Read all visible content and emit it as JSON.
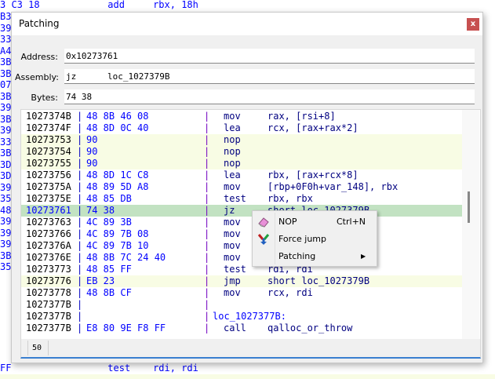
{
  "background": {
    "lines": [
      {
        "text": "3 C3 18            add     rbx, 18h"
      },
      {
        "text": "FF                 test    rdi, rdi"
      }
    ],
    "left_column": [
      "B3",
      "39",
      "33",
      "A4",
      "3B",
      "3B",
      "07",
      "3B",
      "39",
      "3B",
      "39",
      "33",
      "3B",
      "3D",
      "3D",
      "39",
      "35",
      "48",
      "39",
      "39",
      "39",
      "3B",
      "35"
    ]
  },
  "dialog": {
    "title": "Patching",
    "close_label": "x",
    "fields": [
      {
        "label": "Address:",
        "value": "0x10273761"
      },
      {
        "label": "Assembly:",
        "value": "jz      loc_1027379B"
      },
      {
        "label": "Bytes:",
        "value": "74 38"
      }
    ],
    "listing": {
      "rows": [
        {
          "addr": "1027374B",
          "bytes": "48 8B 46 08",
          "mn": "mov",
          "op": "rax, [rsi+8]",
          "hl": ""
        },
        {
          "addr": "1027374F",
          "bytes": "48 8D 0C 40",
          "mn": "lea",
          "op": "rcx, [rax+rax*2]",
          "hl": ""
        },
        {
          "addr": "10273753",
          "bytes": "90",
          "mn": "nop",
          "op": "",
          "hl": "patched"
        },
        {
          "addr": "10273754",
          "bytes": "90",
          "mn": "nop",
          "op": "",
          "hl": "patched"
        },
        {
          "addr": "10273755",
          "bytes": "90",
          "mn": "nop",
          "op": "",
          "hl": "patched"
        },
        {
          "addr": "10273756",
          "bytes": "48 8D 1C C8",
          "mn": "lea",
          "op": "rbx, [rax+rcx*8]",
          "hl": ""
        },
        {
          "addr": "1027375A",
          "bytes": "48 89 5D A8",
          "mn": "mov",
          "op": "[rbp+0F0h+var_148], rbx",
          "hl": ""
        },
        {
          "addr": "1027375E",
          "bytes": "48 85 DB",
          "mn": "test",
          "op": "rbx, rbx",
          "hl": ""
        },
        {
          "addr": "10273761",
          "bytes": "74 38",
          "mn": "jz",
          "op": "short loc_1027379B",
          "hl": "selected"
        },
        {
          "addr": "10273763",
          "bytes": "4C 89 3B",
          "mn": "mov",
          "op": "",
          "hl": ""
        },
        {
          "addr": "10273766",
          "bytes": "4C 89 7B 08",
          "mn": "mov",
          "op": "",
          "hl": ""
        },
        {
          "addr": "1027376A",
          "bytes": "4C 89 7B 10",
          "mn": "mov",
          "op": "",
          "hl": ""
        },
        {
          "addr": "1027376E",
          "bytes": "48 8B 7C 24 40",
          "mn": "mov",
          "op": "",
          "hl": ""
        },
        {
          "addr": "10273773",
          "bytes": "48 85 FF",
          "mn": "test",
          "op": "rdi, rdi",
          "hl": ""
        },
        {
          "addr": "10273776",
          "bytes": "EB 23",
          "mn": "jmp",
          "op": "short loc_1027379B",
          "hl": "patched"
        },
        {
          "addr": "10273778",
          "bytes": "48 8B CF",
          "mn": "mov",
          "op": "rcx, rdi",
          "hl": ""
        },
        {
          "addr": "1027377B",
          "bytes": "",
          "mn": "",
          "op": "",
          "hl": ""
        },
        {
          "addr": "1027377B",
          "bytes": "",
          "mn": "loc_1027377B:",
          "op": "",
          "hl": "label"
        },
        {
          "addr": "1027377B",
          "bytes": "E8 80 9E F8 FF",
          "mn": "call",
          "op": "qalloc_or_throw",
          "hl": ""
        }
      ],
      "status_value": "50"
    }
  },
  "context_menu": {
    "items": [
      {
        "label": "NOP",
        "shortcut": "Ctrl+N",
        "icon": "eraser-icon"
      },
      {
        "label": "Force jump",
        "shortcut": "",
        "icon": "fork-arrow-icon"
      },
      {
        "label": "Patching",
        "shortcut": "",
        "icon": "submenu-arrow-icon"
      }
    ]
  },
  "colors": {
    "patched": "#f8fce4",
    "selected": "#c2e2c2",
    "accent": "#3a7fd0",
    "close": "#c75050"
  }
}
